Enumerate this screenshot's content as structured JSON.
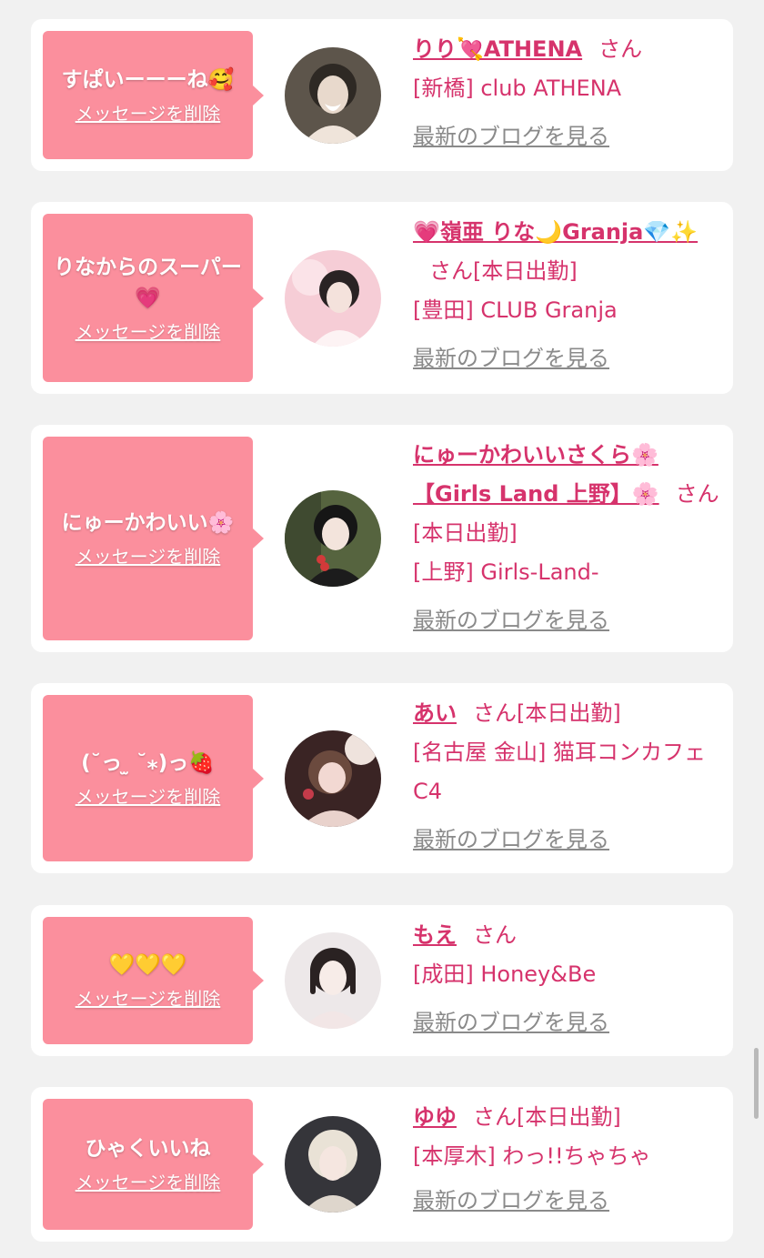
{
  "cards": [
    {
      "message": "すぱいーーーね🥰",
      "delete_label": "メッセージを削除",
      "name": "りり💘ATHENA",
      "san": "さん",
      "status": "",
      "shop": "[新橋] club ATHENA",
      "blog_label": "最新のブログを見る",
      "avatar": {
        "name": "avatar-photo",
        "colors": [
          "#3a332c",
          "#d9c8b8"
        ]
      }
    },
    {
      "message": "りなからのスーパー💗",
      "delete_label": "メッセージを削除",
      "name": "💗嶺亜 りな🌙Granja💎✨",
      "san": "さん",
      "status": "[本日出勤]",
      "shop": "[豊田] CLUB Granja",
      "blog_label": "最新のブログを見る",
      "avatar": {
        "name": "avatar-photo",
        "colors": [
          "#f4c6cf",
          "#2a2324"
        ]
      }
    },
    {
      "message": "にゅーかわいい🌸",
      "delete_label": "メッセージを削除",
      "name": "にゅーかわいいさくら🌸【Girls Land 上野】🌸",
      "san": "さん",
      "status": "[本日出勤]",
      "shop": "[上野] Girls-Land-",
      "blog_label": "最新のブログを見る",
      "avatar": {
        "name": "avatar-photo",
        "colors": [
          "#4c5a3c",
          "#1c1c1c"
        ]
      }
    },
    {
      "message": "(˘っ ̫ ˘⁎)っ🍓",
      "delete_label": "メッセージを削除",
      "name": "あい",
      "san": "さん",
      "status": "[本日出勤]",
      "shop": "[名古屋 金山] 猫耳コンカフェ C4",
      "blog_label": "最新のブログを見る",
      "avatar": {
        "name": "avatar-photo",
        "colors": [
          "#3b2626",
          "#e9c9c2"
        ]
      }
    },
    {
      "message": "💛💛💛",
      "delete_label": "メッセージを削除",
      "name": "もえ",
      "san": "さん",
      "status": "",
      "shop": "[成田] Honey&Be",
      "blog_label": "最新のブログを見る",
      "avatar": {
        "name": "avatar-photo",
        "colors": [
          "#ece7e8",
          "#2a2222"
        ]
      }
    },
    {
      "message": "ひゃくいいね",
      "delete_label": "メッセージを削除",
      "name": "ゆゆ",
      "san": "さん",
      "status": "[本日出勤]",
      "shop": "[本厚木] わっ!!ちゃちゃ",
      "blog_label": "最新のブログを見る",
      "avatar": {
        "name": "avatar-photo",
        "colors": [
          "#2f2f33",
          "#e8e0d8"
        ]
      }
    }
  ],
  "colors": {
    "bubble": "#fb8f9d",
    "accent": "#d6336c",
    "link_gray": "#8a8a8a",
    "background": "#f1f1f1"
  }
}
